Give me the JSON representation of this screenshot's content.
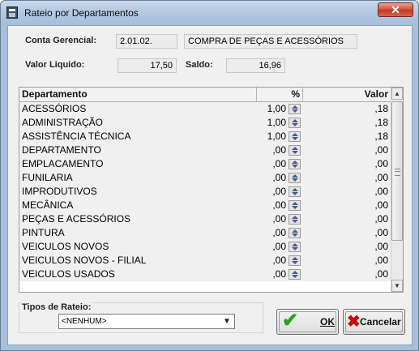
{
  "window": {
    "title": "Rateio por Departamentos",
    "close_label": "✕"
  },
  "header": {
    "conta_label": "Conta Gerencial:",
    "conta_code": "2.01.02.",
    "conta_desc": "COMPRA DE PEÇAS E ACESSÓRIOS",
    "valor_label": "Valor Liquido:",
    "valor_value": "17,50",
    "saldo_label": "Saldo:",
    "saldo_value": "16,96"
  },
  "grid": {
    "columns": [
      "Departamento",
      "%",
      "Valor"
    ],
    "rows": [
      {
        "dept": "ACESSÓRIOS",
        "pct": "1,00",
        "valor": ",18"
      },
      {
        "dept": "ADMINISTRAÇÃO",
        "pct": "1,00",
        "valor": ",18"
      },
      {
        "dept": "ASSISTÊNCIA TÉCNICA",
        "pct": "1,00",
        "valor": ",18"
      },
      {
        "dept": "DEPARTAMENTO",
        "pct": ",00",
        "valor": ",00"
      },
      {
        "dept": "EMPLACAMENTO",
        "pct": ",00",
        "valor": ",00"
      },
      {
        "dept": "FUNILARIA",
        "pct": ",00",
        "valor": ",00"
      },
      {
        "dept": "IMPRODUTIVOS",
        "pct": ",00",
        "valor": ",00"
      },
      {
        "dept": "MECÂNICA",
        "pct": ",00",
        "valor": ",00"
      },
      {
        "dept": "PEÇAS E ACESSÓRIOS",
        "pct": ",00",
        "valor": ",00"
      },
      {
        "dept": "PINTURA",
        "pct": ",00",
        "valor": ",00"
      },
      {
        "dept": "VEICULOS NOVOS",
        "pct": ",00",
        "valor": ",00"
      },
      {
        "dept": "VEICULOS NOVOS - FILIAL",
        "pct": ",00",
        "valor": ",00"
      },
      {
        "dept": "VEICULOS USADOS",
        "pct": ",00",
        "valor": ",00"
      }
    ]
  },
  "tipos": {
    "label": "Tipos de Rateio:",
    "selected": "<NENHUM>"
  },
  "buttons": {
    "ok": "OK",
    "cancel": "Cancelar"
  },
  "colors": {
    "titlebar": "#b3c9e2",
    "close": "#c0391f",
    "ok_check": "#29a01a",
    "cancel_x": "#c01010"
  },
  "icons": [
    "app-icon",
    "close-icon",
    "spin-up-icon",
    "spin-down-icon",
    "scroll-up-icon",
    "scroll-down-icon",
    "dropdown-arrow-icon",
    "check-icon",
    "cancel-x-icon"
  ]
}
